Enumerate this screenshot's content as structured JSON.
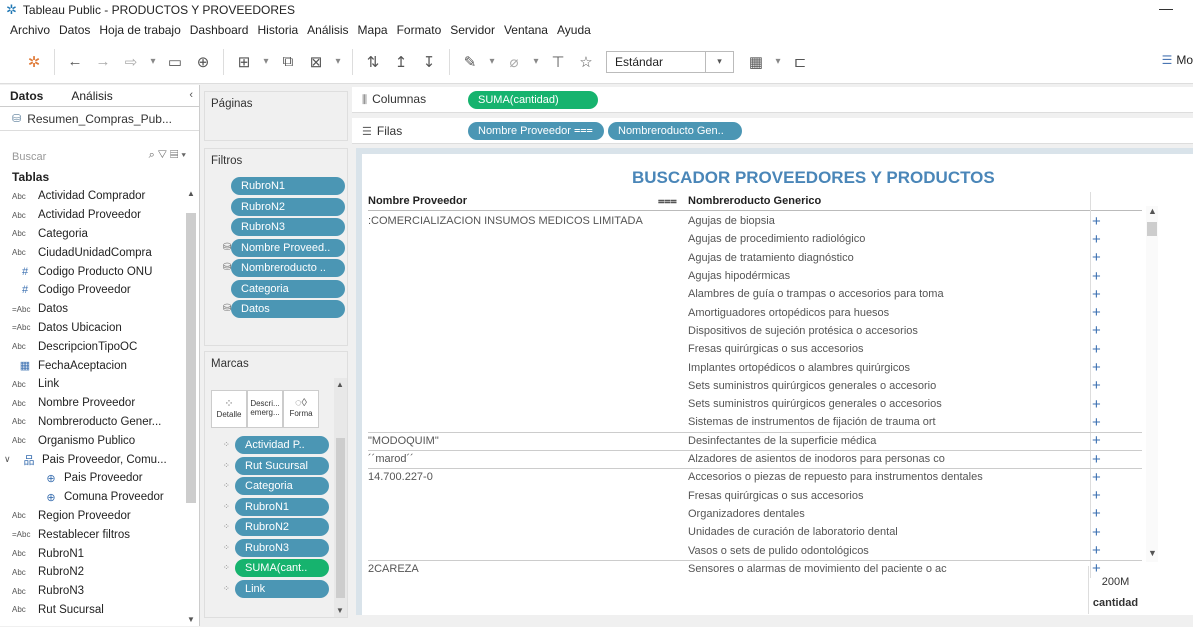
{
  "window": {
    "title": "Tableau Public - PRODUCTOS Y PROVEEDORES"
  },
  "menu": [
    "Archivo",
    "Datos",
    "Hoja de trabajo",
    "Dashboard",
    "Historia",
    "Análisis",
    "Mapa",
    "Formato",
    "Servidor",
    "Ventana",
    "Ayuda"
  ],
  "toolbar": {
    "fit_value": "Estándar",
    "showme_label": "Mo"
  },
  "datapane": {
    "tabs": [
      "Datos",
      "Análisis"
    ],
    "datasource": "Resumen_Compras_Pub...",
    "search_placeholder": "Buscar",
    "tables_heading": "Tablas",
    "fields": [
      {
        "type": "Abc",
        "name": "Actividad Comprador"
      },
      {
        "type": "Abc",
        "name": "Actividad Proveedor"
      },
      {
        "type": "Abc",
        "name": "Categoria"
      },
      {
        "type": "Abc",
        "name": "CiudadUnidadCompra"
      },
      {
        "type": "#",
        "name": "Codigo Producto ONU"
      },
      {
        "type": "#",
        "name": "Codigo Proveedor"
      },
      {
        "type": "=Abc",
        "name": "Datos"
      },
      {
        "type": "=Abc",
        "name": "Datos Ubicacion"
      },
      {
        "type": "Abc",
        "name": "DescripcionTipoOC"
      },
      {
        "type": "date",
        "name": "FechaAceptacion"
      },
      {
        "type": "Abc",
        "name": "Link"
      },
      {
        "type": "Abc",
        "name": "Nombre Proveedor"
      },
      {
        "type": "Abc",
        "name": "Nombreroducto Gener..."
      },
      {
        "type": "Abc",
        "name": "Organismo Publico"
      },
      {
        "type": "hier",
        "name": "Pais Proveedor, Comu..."
      },
      {
        "type": "geo",
        "name": "Pais Proveedor",
        "child": true
      },
      {
        "type": "geo",
        "name": "Comuna Proveedor",
        "child": true
      },
      {
        "type": "Abc",
        "name": "Region Proveedor"
      },
      {
        "type": "=Abc",
        "name": "Restablecer filtros"
      },
      {
        "type": "Abc",
        "name": "RubroN1"
      },
      {
        "type": "Abc",
        "name": "RubroN2"
      },
      {
        "type": "Abc",
        "name": "RubroN3"
      },
      {
        "type": "Abc",
        "name": "Rut Sucursal"
      }
    ]
  },
  "shelves": {
    "pages_label": "Páginas",
    "columns_label": "Columnas",
    "rows_label": "Filas",
    "columns_pills": [
      "SUMA(cantidad)"
    ],
    "rows_pills": [
      "Nombre Proveedor",
      "Nombreroducto Gen.."
    ],
    "filters_label": "Filtros",
    "filters": [
      "RubroN1",
      "RubroN2",
      "RubroN3",
      "Nombre Proveed..",
      "Nombreroducto ..",
      "Categoria",
      "Datos"
    ],
    "marks_label": "Marcas",
    "marks_buttons": [
      "Detalle",
      "Descri... emerg...",
      "Forma"
    ],
    "marks_pills": [
      "Actividad P..",
      "Rut Sucursal",
      "Categoria",
      "RubroN1",
      "RubroN2",
      "RubroN3",
      "SUMA(cant..",
      "Link"
    ]
  },
  "viz": {
    "title": "BUSCADOR PROVEEDORES Y PRODUCTOS",
    "col_headers": [
      "Nombre Proveedor",
      "Nombreroducto Generico"
    ],
    "rows": [
      {
        "prov": ":COMERCIALIZACION INSUMOS MEDICOS LIMITADA",
        "prod": "Agujas de biopsia"
      },
      {
        "prov": "",
        "prod": "Agujas de procedimiento radiológico"
      },
      {
        "prov": "",
        "prod": "Agujas de tratamiento diagnóstico"
      },
      {
        "prov": "",
        "prod": "Agujas hipodérmicas"
      },
      {
        "prov": "",
        "prod": "Alambres de guía o trampas o accesorios para toma"
      },
      {
        "prov": "",
        "prod": "Amortiguadores ortopédicos para huesos"
      },
      {
        "prov": "",
        "prod": "Dispositivos de sujeción protésica o accesorios"
      },
      {
        "prov": "",
        "prod": "Fresas quirúrgicas o sus accesorios"
      },
      {
        "prov": "",
        "prod": "Implantes ortopédicos o alambres quirúrgicos"
      },
      {
        "prov": "",
        "prod": "Sets suministros quirúrgicos generales o accesorio"
      },
      {
        "prov": "",
        "prod": "Sets suministros quirúrgicos generales o accesorios"
      },
      {
        "prov": "",
        "prod": "Sistemas de instrumentos de fijación de trauma ort"
      },
      {
        "prov": "\"MODOQUIM\"",
        "prod": "Desinfectantes de la superficie médica"
      },
      {
        "prov": "´´marod´´",
        "prod": "Alzadores de asientos de inodoros para personas co"
      },
      {
        "prov": "14.700.227-0",
        "prod": "Accesorios o piezas de repuesto para instrumentos dentales"
      },
      {
        "prov": "",
        "prod": "Fresas quirúrgicas o sus accesorios"
      },
      {
        "prov": "",
        "prod": "Organizadores dentales"
      },
      {
        "prov": "",
        "prod": "Unidades de curación de laboratorio dental"
      },
      {
        "prov": "",
        "prod": "Vasos o sets de pulido odontológicos"
      },
      {
        "prov": "2CAREZA",
        "prod": "Sensores o alarmas de movimiento del paciente o ac"
      }
    ],
    "axis_value": "200M",
    "axis_label": "cantidad"
  }
}
